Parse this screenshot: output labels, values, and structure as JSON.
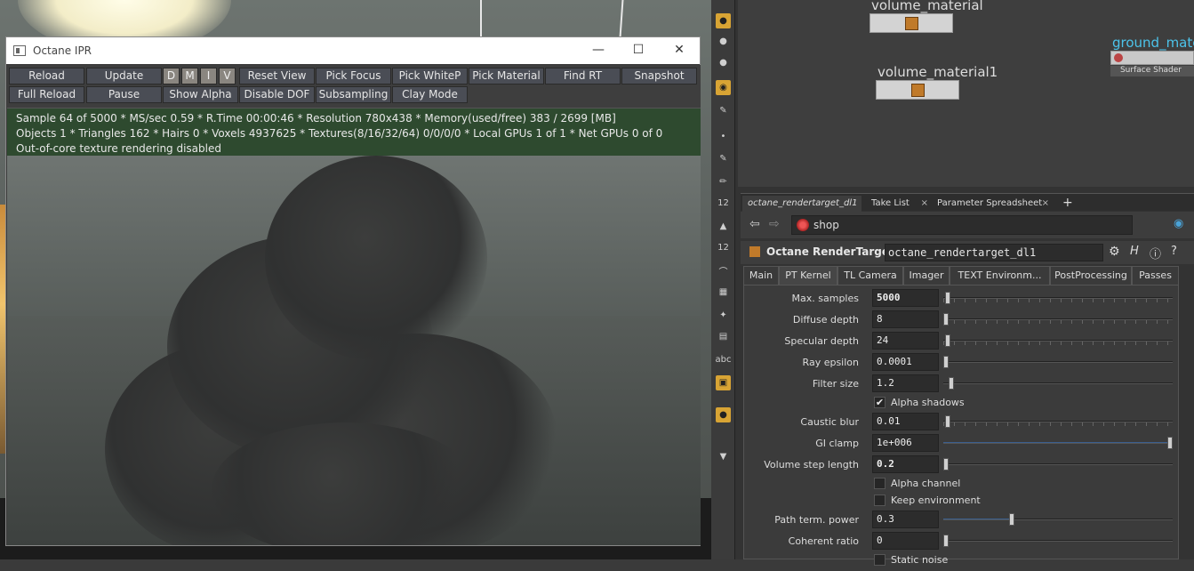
{
  "ipr": {
    "title": "Octane IPR",
    "toolbar_row1": [
      "Reload",
      "Update",
      "D",
      "M",
      "I",
      "V",
      "Reset View",
      "Pick Focus",
      "Pick WhiteP",
      "Pick Material",
      "Find RT",
      "Snapshot"
    ],
    "toolbar_row2": [
      "Full Reload",
      "Pause",
      "Show Alpha",
      "Disable DOF",
      "Subsampling",
      "Clay Mode"
    ],
    "status_lines": [
      "Sample 64 of 5000 * MS/sec 0.59 * R.Time 00:00:46 * Resolution 780x438 * Memory(used/free) 383 / 2699 [MB]",
      "Objects 1 * Triangles 162 * Hairs 0 * Voxels 4937625 * Textures(8/16/32/64) 0/0/0/0 * Local GPUs 1 of 1 * Net GPUs 0 of 0",
      "Out-of-core texture rendering disabled"
    ]
  },
  "nodes": {
    "volume_material": "volume_material",
    "volume_material1": "volume_material1",
    "ground_material": "ground_mate",
    "surface_shader": "Surface Shader"
  },
  "pane_tabs": [
    "octane_rendertarget_dl1",
    "Take List",
    "Parameter Spreadsheet"
  ],
  "path": "shop",
  "node_type": "Octane RenderTarget",
  "node_name": "octane_rendertarget_dl1",
  "sub_tabs": [
    "Main",
    "PT Kernel",
    "TL Camera",
    "Imager",
    "TEXT Environm...",
    "PostProcessing",
    "Passes"
  ],
  "params": [
    {
      "label": "Max. samples",
      "value": "5000",
      "bold": true
    },
    {
      "label": "Diffuse depth",
      "value": "8"
    },
    {
      "label": "Specular depth",
      "value": "24"
    },
    {
      "label": "Ray epsilon",
      "value": "0.0001"
    },
    {
      "label": "Filter size",
      "value": "1.2"
    },
    {
      "check": "Alpha shadows",
      "checked": true
    },
    {
      "label": "Caustic blur",
      "value": "0.01"
    },
    {
      "label": "GI clamp",
      "value": "1e+006",
      "blue": true
    },
    {
      "label": "Volume step length",
      "value": "0.2",
      "bold": true
    },
    {
      "check": "Alpha channel",
      "checked": false
    },
    {
      "check": "Keep environment",
      "checked": false
    },
    {
      "label": "Path term. power",
      "value": "0.3",
      "blue": true
    },
    {
      "label": "Coherent ratio",
      "value": "0"
    },
    {
      "check": "Static noise",
      "checked": false
    }
  ],
  "shelf_labels": {
    "num12a": "12",
    "num12b": "12",
    "abc": "abc"
  }
}
